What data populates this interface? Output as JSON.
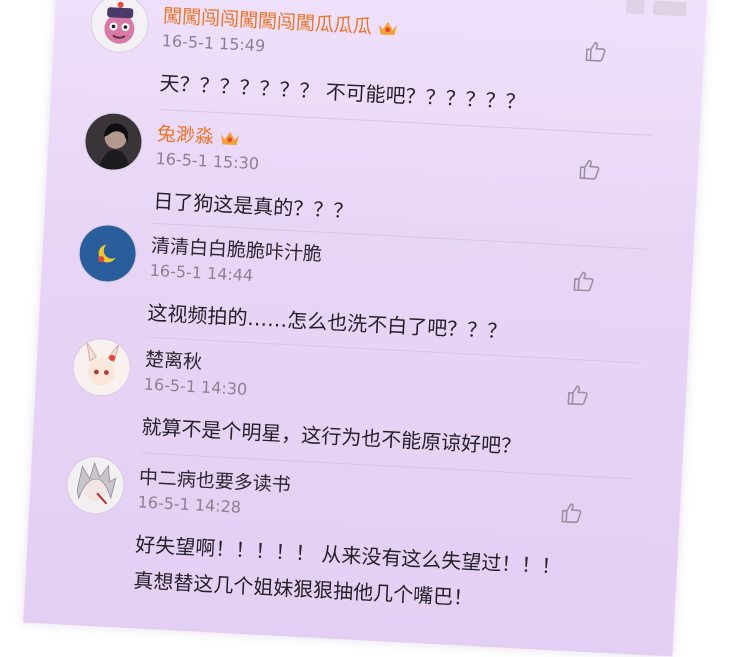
{
  "comments": [
    {
      "name": "闖闖闯闯闖闖闯闖瓜瓜瓜",
      "vip": true,
      "time": "16-5-1 15:49",
      "text": "天？？？？？？？ 不可能吧？？？？？？",
      "avatar_icon": "qing-official-cartoon-avatar"
    },
    {
      "name": "兔渺淼",
      "vip": true,
      "time": "16-5-1 15:30",
      "text": "日了狗这是真的？？？",
      "avatar_icon": "dark-portrait-avatar"
    },
    {
      "name": "清清白白脆脆咔汁脆",
      "vip": false,
      "time": "16-5-1 14:44",
      "text": "这视频拍的……怎么也洗不白了吧？？？",
      "avatar_icon": "blue-moon-bird-avatar"
    },
    {
      "name": "楚离秋",
      "vip": false,
      "time": "16-5-1 14:30",
      "text": "就算不是个明星，这行为也不能原谅好吧？",
      "avatar_icon": "anime-bunny-girl-avatar"
    },
    {
      "name": "中二病也要多读书",
      "vip": false,
      "time": "16-5-1 14:28",
      "text": "好失望啊！！！！！ 从来没有这么失望过！！！",
      "text2": "真想替这几个姐妹狠狠抽他几个嘴巴！",
      "avatar_icon": "anime-silver-hair-avatar"
    }
  ],
  "colors": {
    "vip_name": "#e9772b",
    "tab_indicator": "#f08a3c",
    "background": "#e7d4f6"
  }
}
